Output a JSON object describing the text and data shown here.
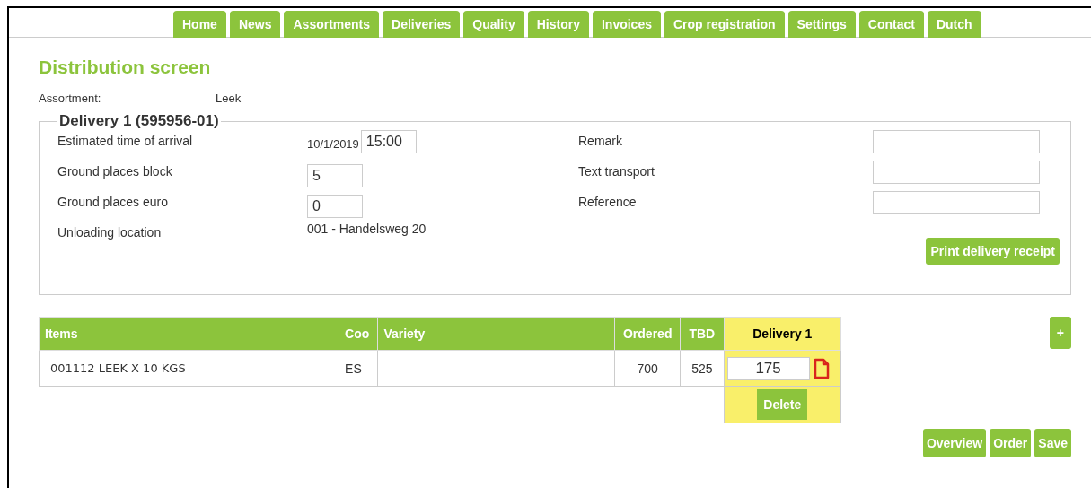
{
  "nav": [
    "Home",
    "News",
    "Assortments",
    "Deliveries",
    "Quality",
    "History",
    "Invoices",
    "Crop registration",
    "Settings",
    "Contact",
    "Dutch"
  ],
  "title": "Distribution screen",
  "assortment": {
    "label": "Assortment:",
    "value": "Leek"
  },
  "delivery": {
    "legend": "Delivery 1 (595956-01)",
    "eta": {
      "label": "Estimated time of arrival",
      "date": "10/1/2019",
      "time": "15:00"
    },
    "block": {
      "label": "Ground places block",
      "value": "5"
    },
    "euro": {
      "label": "Ground places euro",
      "value": "0"
    },
    "unloading": {
      "label": "Unloading location",
      "value": "001 - Handelsweg 20"
    },
    "right_fields": [
      {
        "label": "Remark"
      },
      {
        "label": "Text transport"
      },
      {
        "label": "Reference"
      }
    ],
    "print_button": "Print delivery receipt"
  },
  "table": {
    "columns": [
      "Items",
      "Coo",
      "Variety",
      "Ordered",
      "TBD"
    ],
    "delivery_column": "Delivery 1",
    "rows": [
      {
        "item": "001112 LEEK X 10 KGS",
        "coo": "ES",
        "ordered": "700",
        "tbd": "525",
        "amount": "175"
      }
    ],
    "delete_button": "Delete"
  },
  "add_button": "+",
  "buttons": [
    "Overview",
    "Order",
    "Save"
  ]
}
